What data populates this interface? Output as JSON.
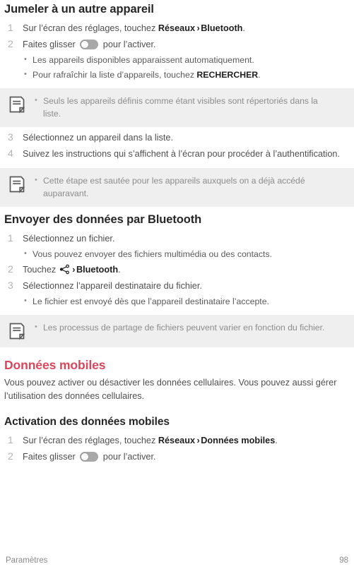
{
  "document": {
    "sections": [
      {
        "id": "pair-device",
        "title": "Jumeler à un autre appareil",
        "title_style": "dark",
        "steps": [
          {
            "num": "1",
            "parts": [
              {
                "t": "text",
                "v": "Sur l’écran des réglages, touchez "
              },
              {
                "t": "bold",
                "v": "Réseaux"
              },
              {
                "t": "sep",
                "v": "›"
              },
              {
                "t": "bold",
                "v": "Bluetooth"
              },
              {
                "t": "text",
                "v": "."
              }
            ]
          },
          {
            "num": "2",
            "parts": [
              {
                "t": "text",
                "v": "Faites glisser "
              },
              {
                "t": "toggle",
                "v": "toggle-switch-icon"
              },
              {
                "t": "text",
                "v": " pour l’activer."
              }
            ]
          }
        ],
        "bullets": [
          "Les appareils disponibles apparaissent automatiquement.",
          {
            "parts": [
              {
                "t": "text",
                "v": "Pour rafraîchir la liste d’appareils, touchez "
              },
              {
                "t": "bold",
                "v": "RECHERCHER"
              },
              {
                "t": "text",
                "v": "."
              }
            ]
          }
        ]
      }
    ],
    "note_1": {
      "icon": "note-document-icon",
      "bullets": [
        "Seuls les appareils définis comme étant visibles sont répertoriés dans la liste."
      ]
    },
    "steps_continued": [
      {
        "num": "3",
        "text": "Sélectionnez un appareil dans la liste."
      },
      {
        "num": "4",
        "text": "Suivez les instructions qui s’affichent à l’écran pour procéder à l’authentification."
      }
    ],
    "note_2": {
      "icon": "note-document-icon",
      "bullets": [
        "Cette étape est sautée pour les appareils auxquels on a déjà accédé auparavant."
      ]
    },
    "send_section": {
      "title": "Envoyer des données par Bluetooth",
      "steps": [
        {
          "num": "1",
          "parts": [
            {
              "t": "text",
              "v": "Sélectionnez un fichier."
            }
          ],
          "bullets": [
            "Vous pouvez envoyer des fichiers multimédia ou des contacts."
          ]
        },
        {
          "num": "2",
          "parts": [
            {
              "t": "text",
              "v": "Touchez "
            },
            {
              "t": "share",
              "v": "share-icon"
            },
            {
              "t": "sep",
              "v": "›"
            },
            {
              "t": "bold",
              "v": "Bluetooth"
            },
            {
              "t": "text",
              "v": "."
            }
          ],
          "bullets": []
        },
        {
          "num": "3",
          "parts": [
            {
              "t": "text",
              "v": "Sélectionnez l’appareil destinataire du fichier."
            }
          ],
          "bullets": [
            "Le fichier est envoyé dès que l’appareil destinataire l’accepte."
          ]
        }
      ]
    },
    "note_3": {
      "icon": "note-document-icon",
      "bullets": [
        "Les processus de partage de fichiers peuvent varier en fonction du fichier."
      ]
    },
    "mobile_data": {
      "title": "Données mobiles",
      "title_color": "#d8475c",
      "paragraph": "Vous pouvez activer ou désactiver les données cellulaires. Vous pouvez aussi gérer l’utilisation des données cellulaires.",
      "sub_title": "Activation des données mobiles",
      "steps": [
        {
          "num": "1",
          "parts": [
            {
              "t": "text",
              "v": "Sur l’écran des réglages, touchez "
            },
            {
              "t": "bold",
              "v": "Réseaux"
            },
            {
              "t": "sep",
              "v": "›"
            },
            {
              "t": "bold",
              "v": "Données mobiles"
            },
            {
              "t": "text",
              "v": "."
            }
          ]
        },
        {
          "num": "2",
          "parts": [
            {
              "t": "text",
              "v": "Faites glisser "
            },
            {
              "t": "toggle",
              "v": "toggle-switch-icon"
            },
            {
              "t": "text",
              "v": " pour l’activer."
            }
          ]
        }
      ]
    },
    "footer": {
      "label": "Paramètres",
      "page_number": "98"
    }
  }
}
